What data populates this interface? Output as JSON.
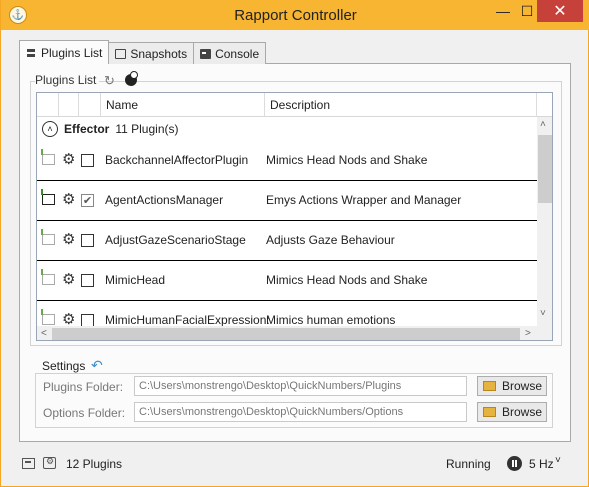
{
  "window": {
    "title": "Rapport Controller",
    "minimize": "—",
    "maximize": "☐",
    "close": "✕",
    "app_icon": "⚓"
  },
  "tabs": [
    {
      "label": "Plugins List",
      "icon": "list-icon",
      "active": true
    },
    {
      "label": "Snapshots",
      "icon": "snapshot-icon",
      "active": false
    },
    {
      "label": "Console",
      "icon": "console-icon",
      "active": false
    }
  ],
  "plugins_list": {
    "label": "Plugins List",
    "refresh_icon": "↻",
    "columns": [
      "Name",
      "Description"
    ],
    "group": {
      "toggle": "˄",
      "name": "Effector",
      "count": "11 Plugin(s)"
    },
    "rows": [
      {
        "name": "BackchannelAffectorPlugin",
        "description": "Mimics Head Nods and Shake",
        "checked": false,
        "active": false
      },
      {
        "name": "AgentActionsManager",
        "description": "Emys Actions Wrapper and Manager",
        "checked": true,
        "active": true
      },
      {
        "name": "AdjustGazeScenarioStage",
        "description": "Adjusts Gaze Behaviour",
        "checked": false,
        "active": false
      },
      {
        "name": "MimicHead",
        "description": "Mimics Head Nods and Shake",
        "checked": false,
        "active": false
      },
      {
        "name": "MimicHumanFacialExpression:",
        "description": "Mimics human emotions",
        "checked": false,
        "active": false
      }
    ],
    "scroll": {
      "up": "˄",
      "down": "˅",
      "left": "˂",
      "right": "˃"
    }
  },
  "settings": {
    "label": "Settings",
    "undo_icon": "↶",
    "plugins_folder": {
      "label": "Plugins Folder:",
      "value": "C:\\Users\\monstrengo\\Desktop\\QuickNumbers/Plugins",
      "browse": "Browse"
    },
    "options_folder": {
      "label": "Options Folder:",
      "value": "C:\\Users\\monstrengo\\Desktop\\QuickNumbers/Options",
      "browse": "Browse"
    }
  },
  "status": {
    "plugins_count": "12 Plugins",
    "state": "Running",
    "rate": "5 Hz",
    "chevron": "˅"
  },
  "colors": {
    "title_bar": "#f7b531",
    "close_button": "#c7413b",
    "accent": "#3a8fd0"
  }
}
